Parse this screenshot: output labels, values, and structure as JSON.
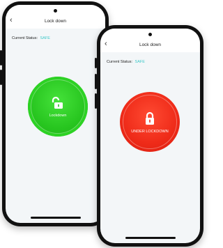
{
  "colors": {
    "safe": "#3cc8c8",
    "green": "#2dd224",
    "red": "#ee2a18"
  },
  "screens": [
    {
      "title": "Lock down",
      "status_label": "Current Status:",
      "status_value": "SAFE",
      "button_label": "Lockdown",
      "icon": "unlocked-padlock-icon"
    },
    {
      "title": "Lock down",
      "status_label": "Current Status:",
      "status_value": "SAFE",
      "button_label": "UNDER LOCKDOWN",
      "icon": "locked-padlock-icon"
    }
  ]
}
